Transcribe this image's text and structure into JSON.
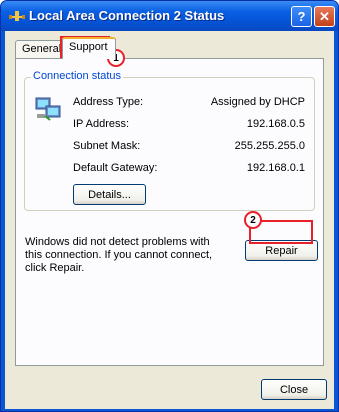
{
  "window": {
    "title": "Local Area Connection 2 Status"
  },
  "tabs": [
    {
      "label": "General",
      "selected": false
    },
    {
      "label": "Support",
      "selected": true
    }
  ],
  "connection_status": {
    "group_label": "Connection status",
    "rows": [
      {
        "label": "Address Type:",
        "value": "Assigned by DHCP"
      },
      {
        "label": "IP Address:",
        "value": "192.168.0.5"
      },
      {
        "label": "Subnet Mask:",
        "value": "255.255.255.0"
      },
      {
        "label": "Default Gateway:",
        "value": "192.168.0.1"
      }
    ],
    "details_label": "Details..."
  },
  "message": "Windows did not detect problems with this connection. If you cannot connect, click Repair.",
  "repair_label": "Repair",
  "close_label": "Close",
  "annotations": [
    {
      "number": "1"
    },
    {
      "number": "2"
    }
  ],
  "colors": {
    "title_bar": "#0a5fe3",
    "highlight": "#e8202a",
    "group_label": "#0046d5",
    "dialog_bg": "#ece9d8"
  }
}
